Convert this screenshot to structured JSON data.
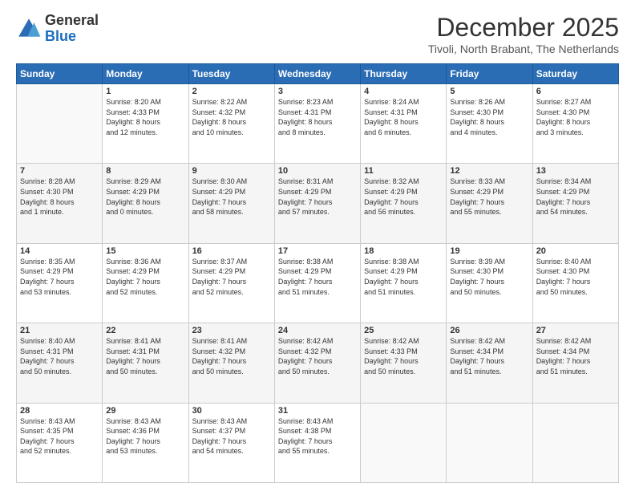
{
  "header": {
    "logo_line1": "General",
    "logo_line2": "Blue",
    "month": "December 2025",
    "location": "Tivoli, North Brabant, The Netherlands"
  },
  "weekdays": [
    "Sunday",
    "Monday",
    "Tuesday",
    "Wednesday",
    "Thursday",
    "Friday",
    "Saturday"
  ],
  "weeks": [
    [
      {
        "day": "",
        "text": ""
      },
      {
        "day": "1",
        "text": "Sunrise: 8:20 AM\nSunset: 4:33 PM\nDaylight: 8 hours\nand 12 minutes."
      },
      {
        "day": "2",
        "text": "Sunrise: 8:22 AM\nSunset: 4:32 PM\nDaylight: 8 hours\nand 10 minutes."
      },
      {
        "day": "3",
        "text": "Sunrise: 8:23 AM\nSunset: 4:31 PM\nDaylight: 8 hours\nand 8 minutes."
      },
      {
        "day": "4",
        "text": "Sunrise: 8:24 AM\nSunset: 4:31 PM\nDaylight: 8 hours\nand 6 minutes."
      },
      {
        "day": "5",
        "text": "Sunrise: 8:26 AM\nSunset: 4:30 PM\nDaylight: 8 hours\nand 4 minutes."
      },
      {
        "day": "6",
        "text": "Sunrise: 8:27 AM\nSunset: 4:30 PM\nDaylight: 8 hours\nand 3 minutes."
      }
    ],
    [
      {
        "day": "7",
        "text": "Sunrise: 8:28 AM\nSunset: 4:30 PM\nDaylight: 8 hours\nand 1 minute."
      },
      {
        "day": "8",
        "text": "Sunrise: 8:29 AM\nSunset: 4:29 PM\nDaylight: 8 hours\nand 0 minutes."
      },
      {
        "day": "9",
        "text": "Sunrise: 8:30 AM\nSunset: 4:29 PM\nDaylight: 7 hours\nand 58 minutes."
      },
      {
        "day": "10",
        "text": "Sunrise: 8:31 AM\nSunset: 4:29 PM\nDaylight: 7 hours\nand 57 minutes."
      },
      {
        "day": "11",
        "text": "Sunrise: 8:32 AM\nSunset: 4:29 PM\nDaylight: 7 hours\nand 56 minutes."
      },
      {
        "day": "12",
        "text": "Sunrise: 8:33 AM\nSunset: 4:29 PM\nDaylight: 7 hours\nand 55 minutes."
      },
      {
        "day": "13",
        "text": "Sunrise: 8:34 AM\nSunset: 4:29 PM\nDaylight: 7 hours\nand 54 minutes."
      }
    ],
    [
      {
        "day": "14",
        "text": "Sunrise: 8:35 AM\nSunset: 4:29 PM\nDaylight: 7 hours\nand 53 minutes."
      },
      {
        "day": "15",
        "text": "Sunrise: 8:36 AM\nSunset: 4:29 PM\nDaylight: 7 hours\nand 52 minutes."
      },
      {
        "day": "16",
        "text": "Sunrise: 8:37 AM\nSunset: 4:29 PM\nDaylight: 7 hours\nand 52 minutes."
      },
      {
        "day": "17",
        "text": "Sunrise: 8:38 AM\nSunset: 4:29 PM\nDaylight: 7 hours\nand 51 minutes."
      },
      {
        "day": "18",
        "text": "Sunrise: 8:38 AM\nSunset: 4:29 PM\nDaylight: 7 hours\nand 51 minutes."
      },
      {
        "day": "19",
        "text": "Sunrise: 8:39 AM\nSunset: 4:30 PM\nDaylight: 7 hours\nand 50 minutes."
      },
      {
        "day": "20",
        "text": "Sunrise: 8:40 AM\nSunset: 4:30 PM\nDaylight: 7 hours\nand 50 minutes."
      }
    ],
    [
      {
        "day": "21",
        "text": "Sunrise: 8:40 AM\nSunset: 4:31 PM\nDaylight: 7 hours\nand 50 minutes."
      },
      {
        "day": "22",
        "text": "Sunrise: 8:41 AM\nSunset: 4:31 PM\nDaylight: 7 hours\nand 50 minutes."
      },
      {
        "day": "23",
        "text": "Sunrise: 8:41 AM\nSunset: 4:32 PM\nDaylight: 7 hours\nand 50 minutes."
      },
      {
        "day": "24",
        "text": "Sunrise: 8:42 AM\nSunset: 4:32 PM\nDaylight: 7 hours\nand 50 minutes."
      },
      {
        "day": "25",
        "text": "Sunrise: 8:42 AM\nSunset: 4:33 PM\nDaylight: 7 hours\nand 50 minutes."
      },
      {
        "day": "26",
        "text": "Sunrise: 8:42 AM\nSunset: 4:34 PM\nDaylight: 7 hours\nand 51 minutes."
      },
      {
        "day": "27",
        "text": "Sunrise: 8:42 AM\nSunset: 4:34 PM\nDaylight: 7 hours\nand 51 minutes."
      }
    ],
    [
      {
        "day": "28",
        "text": "Sunrise: 8:43 AM\nSunset: 4:35 PM\nDaylight: 7 hours\nand 52 minutes."
      },
      {
        "day": "29",
        "text": "Sunrise: 8:43 AM\nSunset: 4:36 PM\nDaylight: 7 hours\nand 53 minutes."
      },
      {
        "day": "30",
        "text": "Sunrise: 8:43 AM\nSunset: 4:37 PM\nDaylight: 7 hours\nand 54 minutes."
      },
      {
        "day": "31",
        "text": "Sunrise: 8:43 AM\nSunset: 4:38 PM\nDaylight: 7 hours\nand 55 minutes."
      },
      {
        "day": "",
        "text": ""
      },
      {
        "day": "",
        "text": ""
      },
      {
        "day": "",
        "text": ""
      }
    ]
  ]
}
